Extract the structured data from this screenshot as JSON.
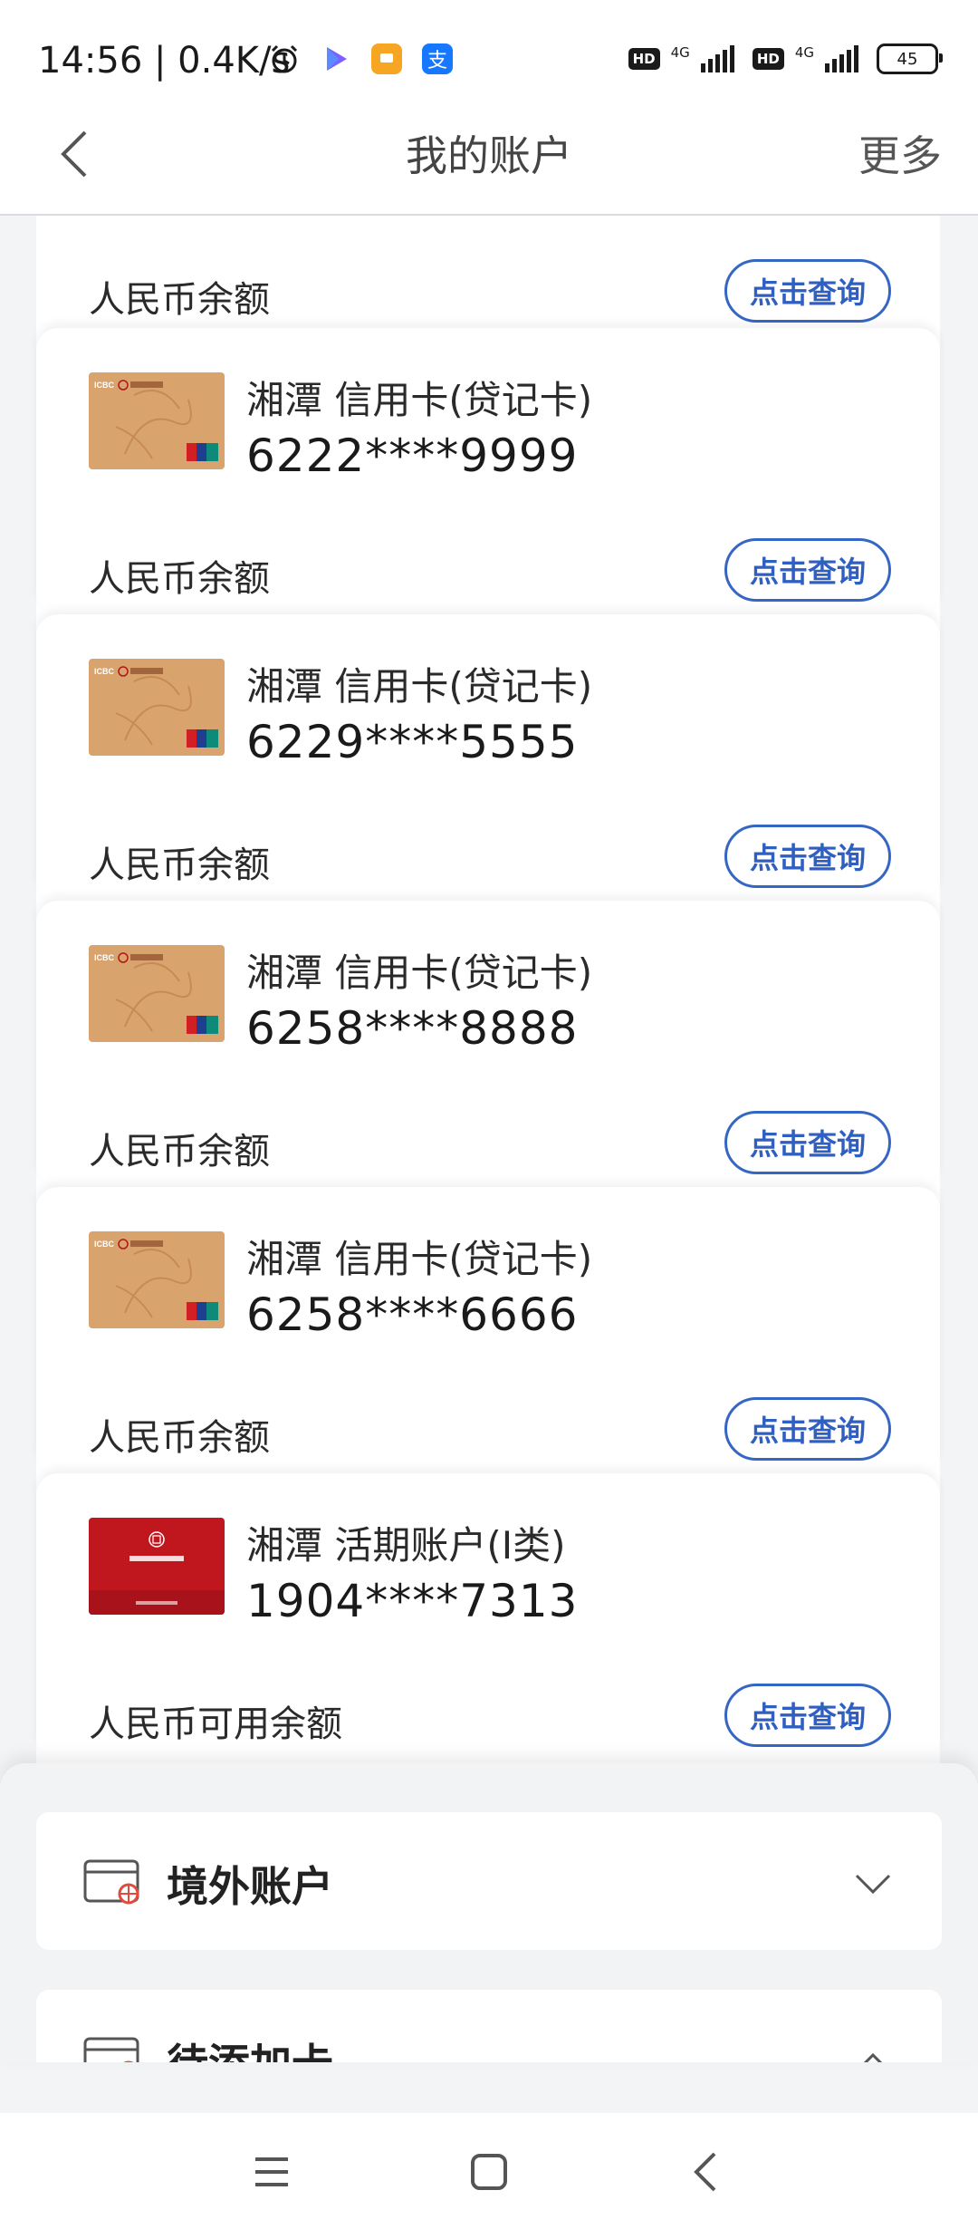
{
  "status_bar": {
    "time": "14:56 | 0.4K/s",
    "network_1": "4G",
    "network_2": "4G",
    "hd_label": "HD",
    "battery": "45"
  },
  "header": {
    "title": "我的账户",
    "more_label": "更多"
  },
  "top_row": {
    "balance_label": "人民币余额",
    "query_label": "点击查询"
  },
  "accounts": [
    {
      "name": "湘潭 信用卡(贷记卡)",
      "number": "6222****9999",
      "balance_label": "人民币余额",
      "query_label": "点击查询",
      "card_style": "gold"
    },
    {
      "name": "湘潭 信用卡(贷记卡)",
      "number": "6229****5555",
      "balance_label": "人民币余额",
      "query_label": "点击查询",
      "card_style": "gold"
    },
    {
      "name": "湘潭 信用卡(贷记卡)",
      "number": "6258****8888",
      "balance_label": "人民币余额",
      "query_label": "点击查询",
      "card_style": "gold"
    },
    {
      "name": "湘潭 信用卡(贷记卡)",
      "number": "6258****6666",
      "balance_label": "人民币余额",
      "query_label": "点击查询",
      "card_style": "gold"
    },
    {
      "name": "湘潭 活期账户(I类)",
      "number": "1904****7313",
      "balance_label": "人民币可用余额",
      "query_label": "点击查询",
      "card_style": "red"
    }
  ],
  "sections": {
    "overseas": "境外账户",
    "pending": "待添加卡"
  },
  "colors": {
    "accent_blue": "#3666c4",
    "card_gold": "#d9a36e",
    "card_red": "#c0161e"
  }
}
